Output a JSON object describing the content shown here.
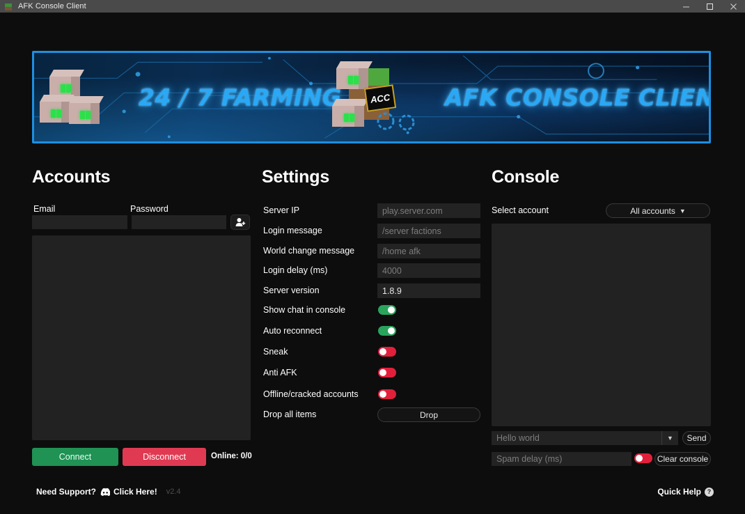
{
  "window": {
    "title": "AFK Console Client",
    "icon": "minecraft-grass-block-icon",
    "minimize": "−",
    "maximize": "□",
    "close": "✕"
  },
  "banner": {
    "left_text": "24 / 7 FARMING",
    "right_text": "AFK CONSOLE CLIENT",
    "plate_text": "ACC",
    "accent_color": "#1d8fe0",
    "text_color": "#29a8f5"
  },
  "accounts": {
    "title": "Accounts",
    "email_label": "Email",
    "password_label": "Password",
    "email_value": "",
    "email_placeholder": "",
    "password_value": "",
    "password_placeholder": "",
    "add_account_icon": "add-user-icon",
    "connect_label": "Connect",
    "disconnect_label": "Disconnect",
    "online_status": "Online: 0/0",
    "connect_color": "#1f9254",
    "disconnect_color": "#e03a52"
  },
  "settings": {
    "title": "Settings",
    "fields": [
      {
        "label": "Server IP",
        "placeholder": "play.server.com",
        "value": ""
      },
      {
        "label": "Login message",
        "placeholder": "/server factions",
        "value": ""
      },
      {
        "label": "World change message",
        "placeholder": "/home afk",
        "value": ""
      },
      {
        "label": "Login delay (ms)",
        "placeholder": "4000",
        "value": ""
      },
      {
        "label": "Server version",
        "placeholder": "",
        "value": "1.8.9"
      }
    ],
    "toggles": [
      {
        "label": "Show chat in console",
        "state": "on"
      },
      {
        "label": "Auto reconnect",
        "state": "on"
      },
      {
        "label": "Sneak",
        "state": "off"
      },
      {
        "label": "Anti AFK",
        "state": "off"
      },
      {
        "label": "Offline/cracked accounts",
        "state": "off"
      }
    ],
    "drop_row_label": "Drop all items",
    "drop_button_label": "Drop",
    "toggle_on_color": "#2aa35c",
    "toggle_off_color": "#e2203c"
  },
  "console": {
    "title": "Console",
    "select_account_label": "Select account",
    "account_dropdown_value": "All accounts",
    "dropdown_caret": "▼",
    "output_text": "",
    "chat_placeholder": "Hello world",
    "chat_value": "",
    "chat_dropdown_caret": "▼",
    "send_label": "Send",
    "spam_delay_placeholder": "Spam delay (ms)",
    "spam_delay_value": "",
    "spam_toggle_state": "off",
    "clear_console_label": "Clear console"
  },
  "footer": {
    "support_prefix": "Need Support?",
    "support_icon": "discord-icon",
    "support_link": "Click Here!",
    "version": "v2.4",
    "quick_help_label": "Quick Help",
    "quick_help_icon": "question-mark-icon",
    "quick_help_glyph": "?"
  }
}
